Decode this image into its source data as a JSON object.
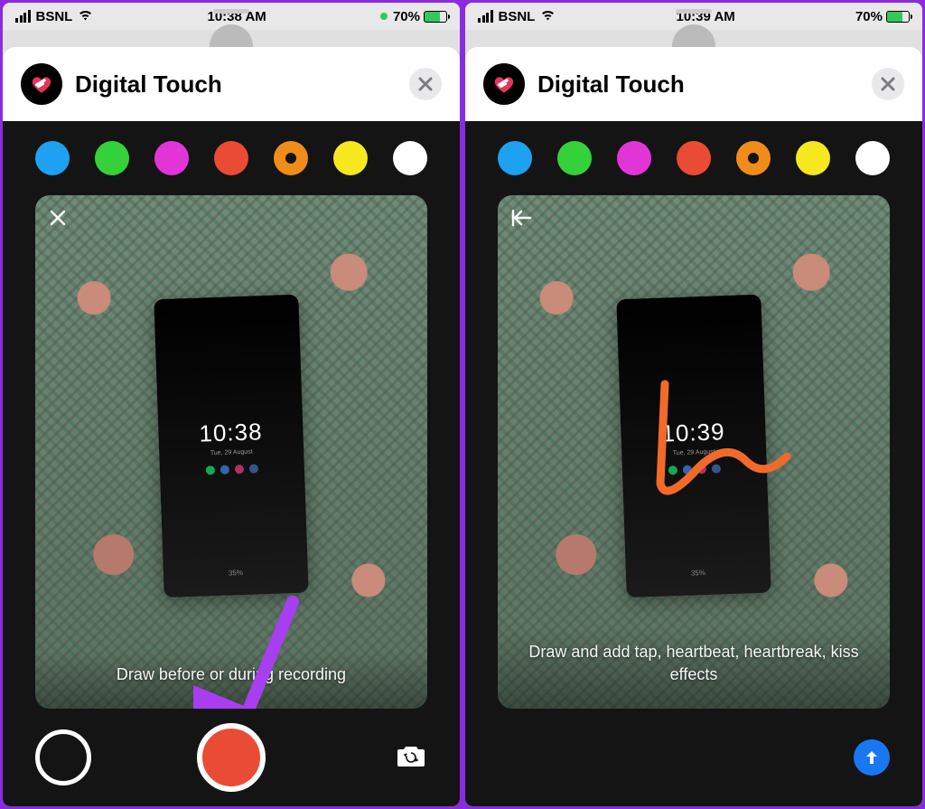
{
  "left": {
    "status": {
      "carrier": "BSNL",
      "time": "10:38 AM",
      "battery": "70%"
    },
    "sheet_title": "Digital Touch",
    "preview": {
      "phone_time": "10:38",
      "phone_sub": "Tue, 29 August",
      "phone_batt": "35%"
    },
    "hint": "Draw before or during recording"
  },
  "right": {
    "status": {
      "carrier": "BSNL",
      "time": "10:39 AM",
      "battery": "70%"
    },
    "sheet_title": "Digital Touch",
    "preview": {
      "phone_time": "10:39",
      "phone_sub": "Tue, 29 August",
      "phone_batt": "35%"
    },
    "hint": "Draw and add tap, heartbeat, heartbreak, kiss effects"
  },
  "colors": {
    "palette": [
      "#1ea1f1",
      "#35d13a",
      "#e235d8",
      "#e94b35",
      "#f08c1a",
      "#f6e71e",
      "#ffffff"
    ],
    "ring_index": 4
  }
}
